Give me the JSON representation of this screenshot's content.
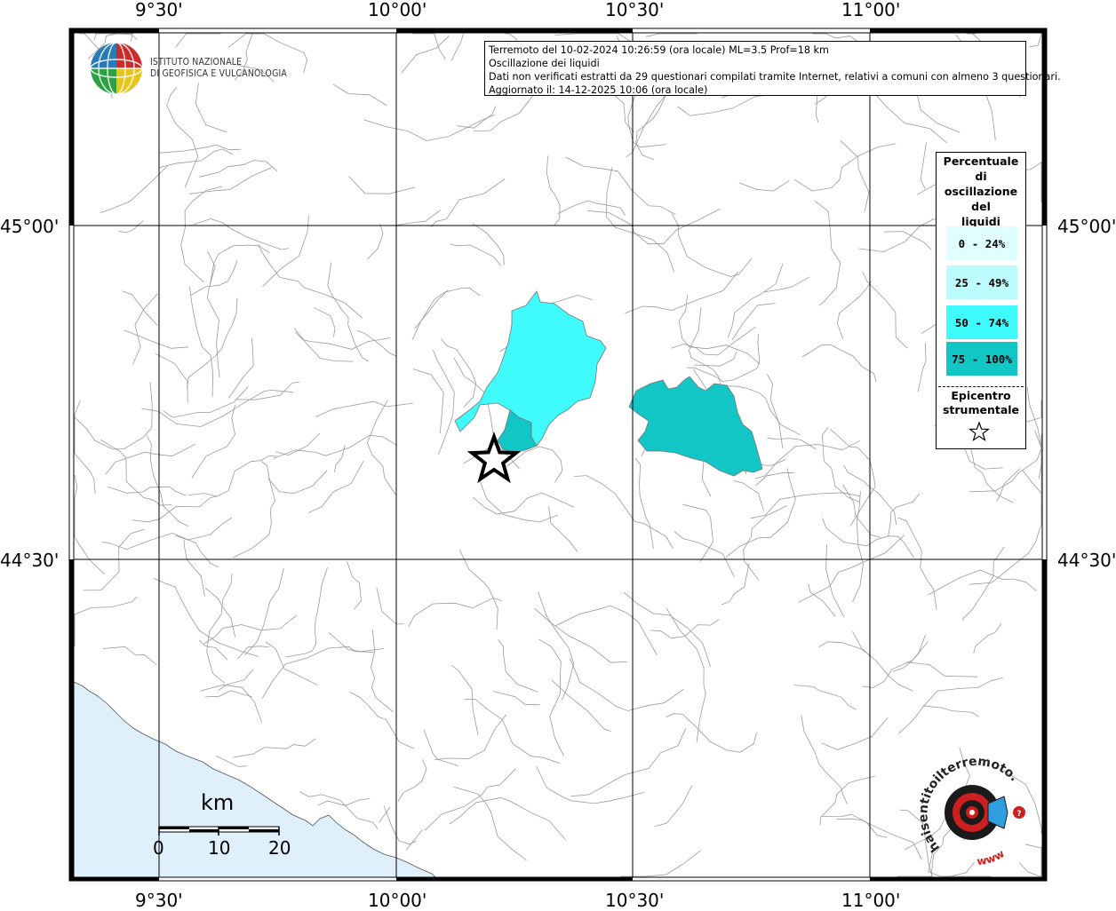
{
  "map": {
    "lon_labels": [
      "9°30'",
      "10°00'",
      "10°30'",
      "11°00'"
    ],
    "lat_labels": [
      "45°00'",
      "44°30'"
    ]
  },
  "info": {
    "line1": "Terremoto del 10-02-2024 10:26:59 (ora locale) ML=3.5 Prof=18 km",
    "line2": "Oscillazione dei liquidi",
    "line3": "Dati non verificati estratti da 29 questionari compilati tramite Internet, relativi a comuni con almeno 3 questionari.",
    "line4": "Aggiornato il: 14-12-2025 10:06 (ora locale)"
  },
  "legend": {
    "title_lines": [
      "Percentuale",
      "di",
      "oscillazione",
      "del",
      "liquidi"
    ],
    "classes": [
      {
        "label": "0 - 24%",
        "color": "#e0ffff"
      },
      {
        "label": "25 - 49%",
        "color": "#bdfcfc"
      },
      {
        "label": "50 - 74%",
        "color": "#3ffbfb"
      },
      {
        "label": "75 - 100%",
        "color": "#12c6c6"
      }
    ],
    "epicenter_lines": [
      "Epicentro",
      "strumentale"
    ]
  },
  "ingv": {
    "line1": "ISTITUTO NAZIONALE",
    "line2": "DI GEOFISICA E VULCANOLOGIA"
  },
  "scale": {
    "unit": "km",
    "ticks": [
      "0",
      "10",
      "20"
    ]
  },
  "hsit": {
    "text": "haisentitoilterremoto.it",
    "url_text": "www"
  },
  "colors": {
    "sea": "#dff0fb",
    "class_50_74": "#3ffbfb",
    "class_75_100": "#12c6c6"
  }
}
